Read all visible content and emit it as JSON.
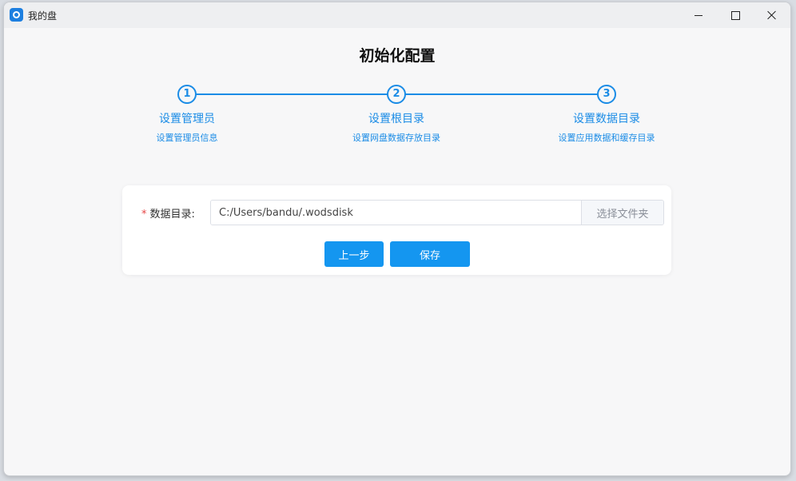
{
  "window": {
    "title": "我的盘"
  },
  "page": {
    "title": "初始化配置"
  },
  "steps": [
    {
      "number": "1",
      "title": "设置管理员",
      "desc": "设置管理员信息"
    },
    {
      "number": "2",
      "title": "设置根目录",
      "desc": "设置网盘数据存放目录"
    },
    {
      "number": "3",
      "title": "设置数据目录",
      "desc": "设置应用数据和缓存目录"
    }
  ],
  "form": {
    "required_mark": "*",
    "data_dir_label": "数据目录:",
    "data_dir_value": "C:/Users/bandu/.wodsdisk",
    "choose_folder_label": "选择文件夹",
    "prev_label": "上一步",
    "save_label": "保存"
  },
  "colors": {
    "accent": "#1496f0",
    "step": "#1b8ce6",
    "required": "#e64545"
  }
}
